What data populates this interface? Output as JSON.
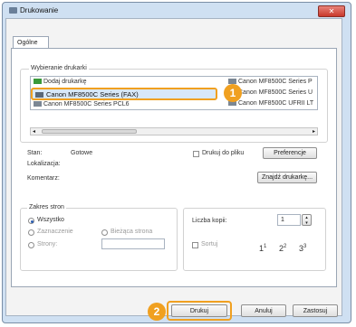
{
  "window": {
    "title": "Drukowanie",
    "close_label": "✕"
  },
  "tab": {
    "label": "Ogólne"
  },
  "printer_group": {
    "label": "Wybieranie drukarki",
    "items": [
      "Dodaj drukarkę",
      "Canon MF8500C Series (FAX)",
      "Canon MF8500C Series PCL6",
      "Canon MF8500C Series P",
      "Canon MF8500C Series U",
      "Canon MF8500C UFRII LT"
    ],
    "selected": "Canon MF8500C Series (FAX)"
  },
  "status": {
    "stan_label": "Stan:",
    "stan_value": "Gotowe",
    "lokalizacja_label": "Lokalizacja:",
    "komentarz_label": "Komentarz:"
  },
  "print_to_file_label": "Drukuj do pliku",
  "preferences_label": "Preferencje",
  "find_printer_label": "Znajdź drukarkę...",
  "range_group": {
    "label": "Zakres stron",
    "all": "Wszystko",
    "selection": "Zaznaczenie",
    "current": "Bieżąca strona",
    "pages": "Strony:"
  },
  "copies": {
    "label": "Liczba kopii:",
    "value": "1"
  },
  "collate_label": "Sortuj",
  "buttons": {
    "print": "Drukuj",
    "cancel": "Anuluj",
    "apply": "Zastosuj"
  },
  "callouts": [
    "1",
    "2"
  ],
  "colors": {
    "accent": "#f0a020",
    "close": "#c8382b"
  }
}
